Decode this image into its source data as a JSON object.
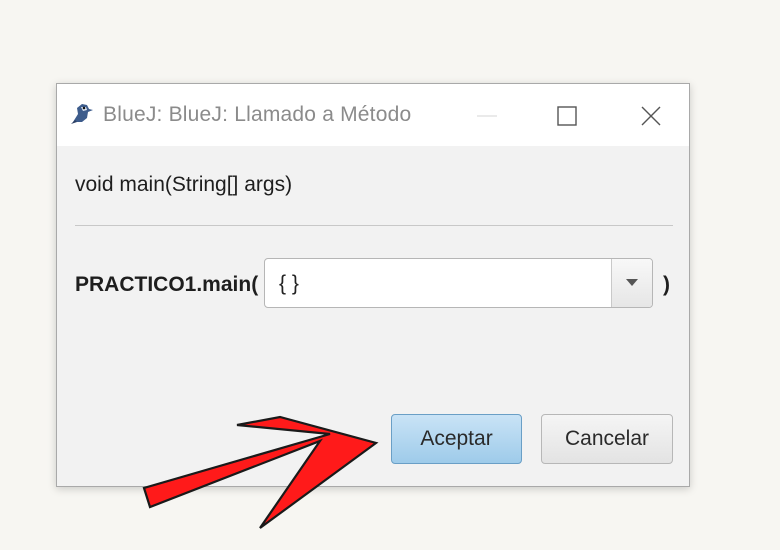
{
  "window": {
    "title": "BlueJ:  BlueJ:  Llamado a Método",
    "app_icon": "bluej-bird-icon",
    "controls": [
      "minimize-icon",
      "maximize-icon",
      "close-icon"
    ]
  },
  "dialog": {
    "signature": "void main(String[] args)",
    "call_prefix": "PRACTICO1.main(",
    "argument_value": "{ }",
    "call_suffix": ")",
    "buttons": {
      "ok_label": "Aceptar",
      "cancel_label": "Cancelar"
    }
  },
  "annotation": {
    "icon": "red-arrow-icon",
    "color": "#ff1a1a"
  },
  "colors": {
    "background": "#f7f6f2",
    "dialog_body": "#f2f2f2",
    "ok_button": "#b4d7f0",
    "arrow": "#ff1a1a"
  }
}
